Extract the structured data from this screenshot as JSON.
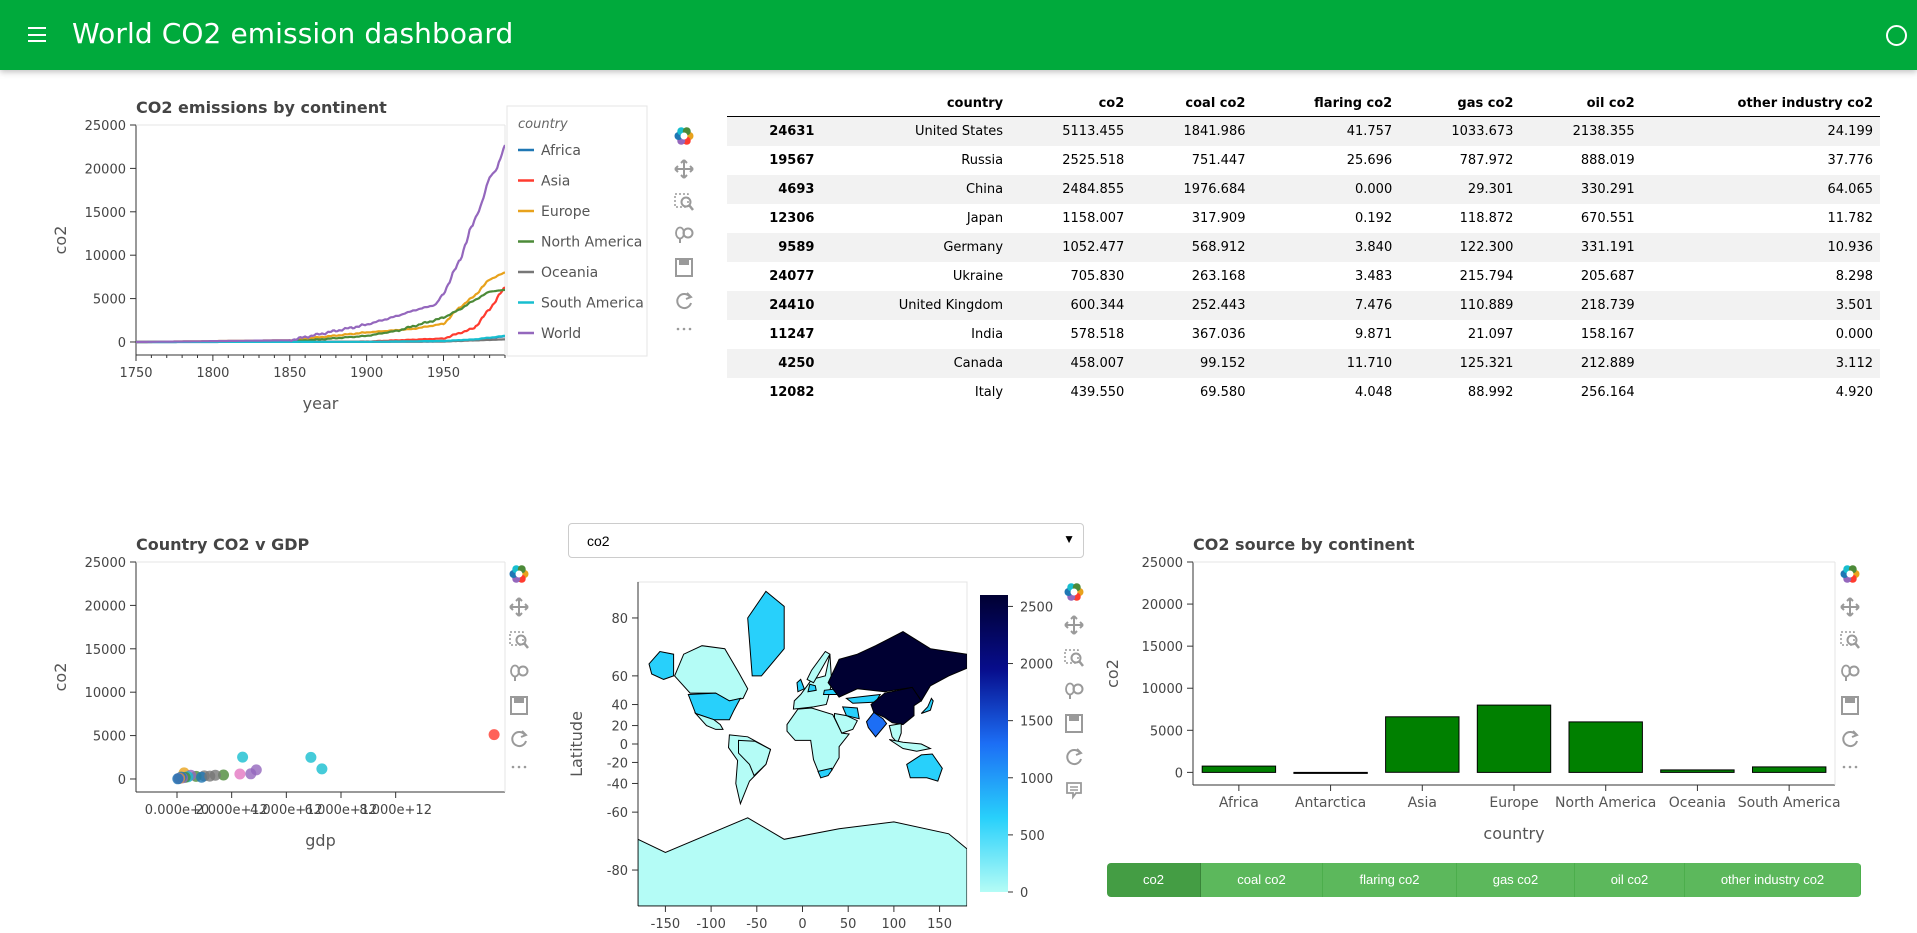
{
  "header": {
    "title": "World CO2 emission dashboard",
    "bg_color": "#00aa3c"
  },
  "continent_lines": {
    "title": "CO2 emissions by continent",
    "legend_title": "country"
  },
  "gdp_scatter": {
    "title": "Country CO2 v GDP"
  },
  "map": {
    "variable_select": {
      "value": "co2",
      "arrow": "▼"
    }
  },
  "source_bars": {
    "title": "CO2 source by continent"
  },
  "source_buttons": {
    "options": [
      "co2",
      "coal co2",
      "flaring co2",
      "gas co2",
      "oil co2",
      "other industry co2"
    ],
    "active": "co2"
  },
  "top_table": {
    "columns": [
      "",
      "country",
      "co2",
      "coal co2",
      "flaring co2",
      "gas co2",
      "oil co2",
      "other industry co2"
    ],
    "rows": [
      [
        "24631",
        "United States",
        "5113.455",
        "1841.986",
        "41.757",
        "1033.673",
        "2138.355",
        "24.199"
      ],
      [
        "19567",
        "Russia",
        "2525.518",
        "751.447",
        "25.696",
        "787.972",
        "888.019",
        "37.776"
      ],
      [
        "4693",
        "China",
        "2484.855",
        "1976.684",
        "0.000",
        "29.301",
        "330.291",
        "64.065"
      ],
      [
        "12306",
        "Japan",
        "1158.007",
        "317.909",
        "0.192",
        "118.872",
        "670.551",
        "11.782"
      ],
      [
        "9589",
        "Germany",
        "1052.477",
        "568.912",
        "3.840",
        "122.300",
        "331.191",
        "10.936"
      ],
      [
        "24077",
        "Ukraine",
        "705.830",
        "263.168",
        "3.483",
        "215.794",
        "205.687",
        "8.298"
      ],
      [
        "24410",
        "United Kingdom",
        "600.344",
        "252.443",
        "7.476",
        "110.889",
        "218.739",
        "3.501"
      ],
      [
        "11247",
        "India",
        "578.518",
        "367.036",
        "9.871",
        "21.097",
        "158.167",
        "0.000"
      ],
      [
        "4250",
        "Canada",
        "458.007",
        "99.152",
        "11.710",
        "125.321",
        "212.889",
        "3.112"
      ],
      [
        "12082",
        "Italy",
        "439.550",
        "69.580",
        "4.048",
        "88.992",
        "256.164",
        "4.920"
      ]
    ]
  },
  "chart_data": [
    {
      "type": "line",
      "title": "CO2 emissions by continent",
      "xlabel": "year",
      "ylabel": "co2",
      "xlim": [
        1750,
        1990
      ],
      "ylim": [
        -1500,
        25000
      ],
      "x_ticks": [
        1750,
        1800,
        1850,
        1900,
        1950
      ],
      "y_ticks": [
        0,
        5000,
        10000,
        15000,
        20000,
        25000
      ],
      "legend_title": "country",
      "legend_position": "right",
      "series": [
        {
          "name": "Africa",
          "color": "#1f77b4",
          "x": [
            1750,
            1900,
            1950,
            1970,
            1990
          ],
          "values": [
            0,
            10,
            60,
            250,
            650
          ]
        },
        {
          "name": "Asia",
          "color": "#ff3b2f",
          "x": [
            1750,
            1900,
            1950,
            1970,
            1980,
            1990
          ],
          "values": [
            0,
            50,
            400,
            1600,
            3800,
            6300
          ]
        },
        {
          "name": "Europe",
          "color": "#e8a21c",
          "x": [
            1750,
            1850,
            1900,
            1930,
            1950,
            1960,
            1970,
            1980,
            1990
          ],
          "values": [
            0,
            200,
            1100,
            1500,
            2100,
            3900,
            5300,
            7200,
            8000
          ]
        },
        {
          "name": "North America",
          "color": "#4c8a38",
          "x": [
            1750,
            1850,
            1900,
            1920,
            1950,
            1960,
            1970,
            1980,
            1990
          ],
          "values": [
            0,
            50,
            700,
            1300,
            2800,
            3700,
            4800,
            5800,
            6000
          ]
        },
        {
          "name": "Oceania",
          "color": "#777777",
          "x": [
            1750,
            1900,
            1950,
            1990
          ],
          "values": [
            0,
            20,
            60,
            300
          ]
        },
        {
          "name": "South America",
          "color": "#17becf",
          "x": [
            1750,
            1900,
            1950,
            1970,
            1990
          ],
          "values": [
            0,
            20,
            120,
            300,
            700
          ]
        },
        {
          "name": "World",
          "color": "#9467bd",
          "x": [
            1750,
            1850,
            1900,
            1920,
            1930,
            1945,
            1950,
            1960,
            1970,
            1975,
            1980,
            1985,
            1990
          ],
          "values": [
            0,
            200,
            2000,
            3000,
            3600,
            4300,
            5600,
            9200,
            14000,
            16000,
            19000,
            20000,
            22700
          ]
        }
      ]
    },
    {
      "type": "scatter",
      "title": "Country CO2 v GDP",
      "xlabel": "gdp",
      "ylabel": "co2",
      "xlim": [
        -1500000000000.0,
        12000000000000.0
      ],
      "ylim": [
        -1500,
        25000
      ],
      "x_ticks": [
        0,
        2000000000000.0,
        4000000000000.0,
        6000000000000.0,
        8000000000000.0
      ],
      "x_tick_labels": [
        "0.000e+0",
        "2.000e+12",
        "4.000e+12",
        "6.000e+12",
        "8.000e+12"
      ],
      "y_ticks": [
        0,
        5000,
        10000,
        15000,
        20000,
        25000
      ],
      "points": [
        {
          "x": 11600000000000.0,
          "y": 5113,
          "color": "#ff3b2f"
        },
        {
          "x": 2400000000000.0,
          "y": 2525,
          "color": "#17becf"
        },
        {
          "x": 4900000000000.0,
          "y": 2485,
          "color": "#17becf"
        },
        {
          "x": 5300000000000.0,
          "y": 1158,
          "color": "#17becf"
        },
        {
          "x": 2900000000000.0,
          "y": 1052,
          "color": "#9467bd"
        },
        {
          "x": 260000000000.0,
          "y": 706,
          "color": "#e8a21c"
        },
        {
          "x": 2700000000000.0,
          "y": 600,
          "color": "#9467bd"
        },
        {
          "x": 2300000000000.0,
          "y": 579,
          "color": "#e377c2"
        },
        {
          "x": 1700000000000.0,
          "y": 458,
          "color": "#4c8a38"
        },
        {
          "x": 1400000000000.0,
          "y": 440,
          "color": "#777777"
        },
        {
          "x": 1000000000000.0,
          "y": 350,
          "color": "#777777"
        },
        {
          "x": 700000000000.0,
          "y": 300,
          "color": "#4c8a38"
        },
        {
          "x": 500000000000.0,
          "y": 420,
          "color": "#9467bd"
        },
        {
          "x": 400000000000.0,
          "y": 250,
          "color": "#17becf"
        },
        {
          "x": 300000000000.0,
          "y": 180,
          "color": "#4c8a38"
        },
        {
          "x": 200000000000.0,
          "y": 120,
          "color": "#9467bd"
        },
        {
          "x": 150000000000.0,
          "y": 220,
          "color": "#1f77b4"
        },
        {
          "x": 100000000000.0,
          "y": 80,
          "color": "#e8a21c"
        },
        {
          "x": 60000000000.0,
          "y": 50,
          "color": "#9467bd"
        },
        {
          "x": 30000000000.0,
          "y": 20,
          "color": "#1f77b4"
        },
        {
          "x": 900000000000.0,
          "y": 210,
          "color": "#1f77b4"
        },
        {
          "x": 1200000000000.0,
          "y": 330,
          "color": "#777777"
        }
      ]
    },
    {
      "type": "heatmap",
      "title": "",
      "xlabel": "",
      "ylabel": "Latitude",
      "xlim": [
        -180,
        180
      ],
      "ylim": [
        -90,
        90
      ],
      "x_ticks": [
        -150,
        -100,
        -50,
        0,
        50,
        100,
        150
      ],
      "y_ticks": [
        80,
        60,
        40,
        20,
        0,
        -20,
        -40,
        -60,
        -80
      ],
      "colorbar_ticks": [
        0,
        500,
        1000,
        1500,
        2000,
        2500
      ],
      "colorbar_range": [
        0,
        2600
      ],
      "colormap": [
        "#b4fcf6",
        "#28d0fb",
        "#1c6ef5",
        "#070d8c",
        "#000032"
      ]
    },
    {
      "type": "bar",
      "title": "CO2 source by continent",
      "xlabel": "country",
      "ylabel": "co2",
      "ylim": [
        -1500,
        25000
      ],
      "y_ticks": [
        0,
        5000,
        10000,
        15000,
        20000,
        25000
      ],
      "categories": [
        "Africa",
        "Antarctica",
        "Asia",
        "Europe",
        "North America",
        "Oceania",
        "South America"
      ],
      "values": [
        750,
        0,
        6600,
        8000,
        6000,
        300,
        650
      ],
      "color": "#008000"
    }
  ]
}
